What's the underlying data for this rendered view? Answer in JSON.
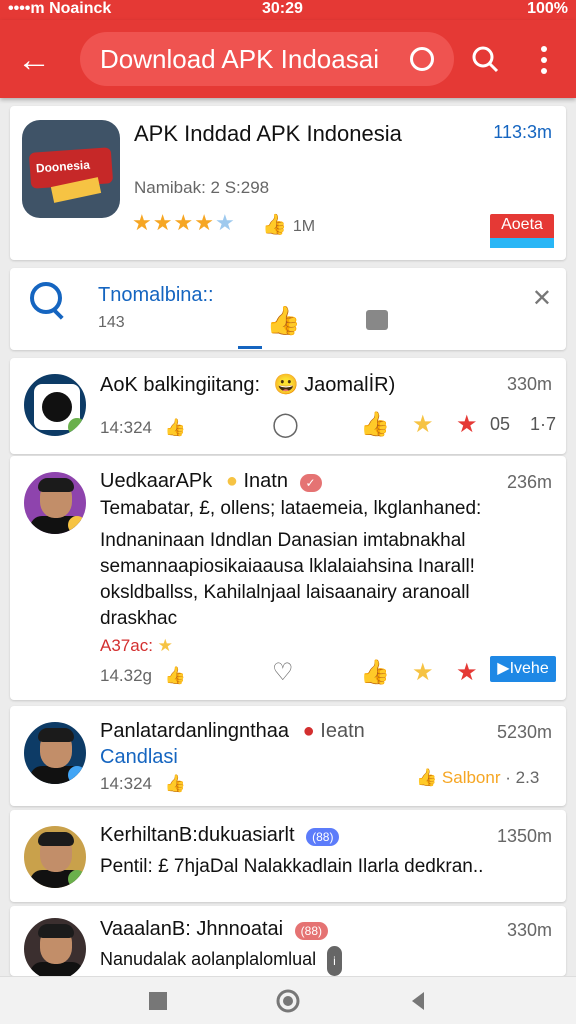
{
  "status_bar": {
    "left": "••••m Noainck",
    "center": "30:29",
    "right": "100%"
  },
  "appbar": {
    "search_query": "Download APK Indoasai"
  },
  "app": {
    "title": "APK Inddad APK Indonesia",
    "time": "113:3m",
    "meta": "Namibak: 2 S:298",
    "likes": "1M",
    "badge": "Aoeta",
    "icon_text": "Doonesia",
    "rating_stars": 4.5
  },
  "filter": {
    "title": "Tnomalbina::",
    "count": "143"
  },
  "comments": [
    {
      "name": "AoK balkingiitang:",
      "tag": "JaomalİR)",
      "time": "330m",
      "meta": "14:324",
      "icon_count": "05",
      "icon_count2": "1·7"
    },
    {
      "name": "UedkaarAPk",
      "tag": "Inatn",
      "time": "236m",
      "line1": "Temabatar, £, ollens; lataemeia, lkglanhaned:",
      "line2": "Indnaninaan Idndlan Danasian imtabnakhal",
      "line3": "semannaapiosikaiaausa lklalaiahsina Inarall!",
      "line4": "oksldballss, Kahilalnjaal laisaanairy aranoall",
      "line5": "draskhac",
      "small_red": "A37ac:",
      "meta": "14.32g",
      "reply_label": "Ivehe"
    },
    {
      "name": "Panlatardanlingnthaa",
      "tag": "Ieatn",
      "time": "5230m",
      "sub": "Candlasi",
      "meta": "14:324",
      "small": "Salbonr",
      "count": "2.3"
    },
    {
      "name": "KerhiltanB:dukuasiarlt",
      "tag": "(88)",
      "time": "1350m",
      "body": "Pentil: £ 7hjaDal Nalakkadlain Ilarla dedkran.."
    },
    {
      "name": "VaaalanB: Jhnnoatai",
      "tag": "(88)",
      "time": "330m",
      "body": "Nanudalak aolanplalomlual"
    }
  ]
}
